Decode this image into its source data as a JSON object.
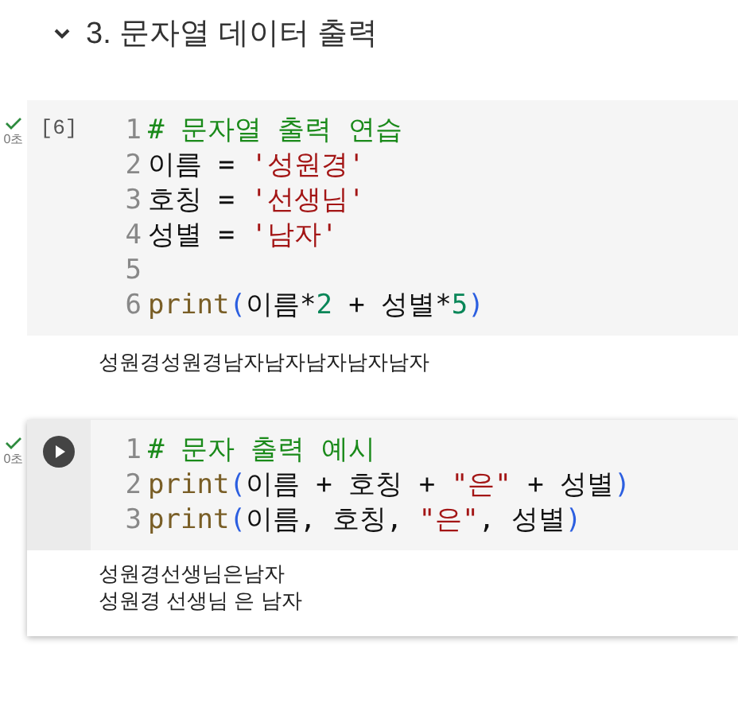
{
  "section": {
    "expanded": true,
    "title": "3. 문자열 데이터 출력"
  },
  "cells": [
    {
      "done": true,
      "status": "0초",
      "focused": false,
      "execution_count": "[6]",
      "lines": [
        {
          "number": "1",
          "tokens": [
            {
              "kind": "comment",
              "text": "# 문자열 출력 연습"
            }
          ]
        },
        {
          "number": "2",
          "tokens": [
            {
              "kind": "plain",
              "text": "이름 = "
            },
            {
              "kind": "string",
              "text": "'성원경'"
            }
          ]
        },
        {
          "number": "3",
          "tokens": [
            {
              "kind": "plain",
              "text": "호칭 = "
            },
            {
              "kind": "string",
              "text": "'선생님'"
            }
          ]
        },
        {
          "number": "4",
          "tokens": [
            {
              "kind": "plain",
              "text": "성별 = "
            },
            {
              "kind": "string",
              "text": "'남자'"
            }
          ]
        },
        {
          "number": "5"
        },
        {
          "number": "6",
          "tokens": [
            {
              "kind": "function",
              "text": "print"
            },
            {
              "kind": "paren",
              "text": "("
            },
            {
              "kind": "plain",
              "text": "이름*"
            },
            {
              "kind": "number",
              "text": "2"
            },
            {
              "kind": "plain",
              "text": " + 성별*"
            },
            {
              "kind": "number",
              "text": "5"
            },
            {
              "kind": "paren",
              "text": ")"
            }
          ]
        }
      ],
      "output": [
        "성원경성원경남자남자남자남자남자"
      ]
    },
    {
      "done": true,
      "status": "0초",
      "focused": true,
      "lines": [
        {
          "number": "1",
          "tokens": [
            {
              "kind": "comment",
              "text": "# 문자 출력 예시"
            }
          ]
        },
        {
          "number": "2",
          "tokens": [
            {
              "kind": "function",
              "text": "print"
            },
            {
              "kind": "paren",
              "text": "("
            },
            {
              "kind": "plain",
              "text": "이름 + 호칭 + "
            },
            {
              "kind": "string",
              "text": "\"은\""
            },
            {
              "kind": "plain",
              "text": " + 성별"
            },
            {
              "kind": "paren",
              "text": ")"
            }
          ]
        },
        {
          "number": "3",
          "tokens": [
            {
              "kind": "function",
              "text": "print"
            },
            {
              "kind": "paren",
              "text": "("
            },
            {
              "kind": "plain",
              "text": "이름, 호칭, "
            },
            {
              "kind": "string",
              "text": "\"은\""
            },
            {
              "kind": "plain",
              "text": ", 성별"
            },
            {
              "kind": "paren",
              "text": ")"
            }
          ]
        }
      ],
      "output": [
        "성원경선생님은남자",
        "성원경 선생님 은 남자"
      ]
    }
  ]
}
